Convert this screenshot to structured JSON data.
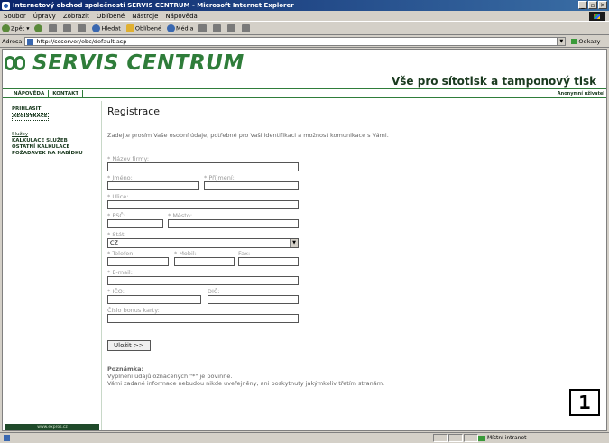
{
  "window": {
    "title": "Internetový obchod společnosti SERVIS CENTRUM - Microsoft Internet Explorer",
    "controls": [
      "_",
      "▫",
      "✕"
    ]
  },
  "menu": [
    "Soubor",
    "Úpravy",
    "Zobrazit",
    "Oblíbené",
    "Nástroje",
    "Nápověda"
  ],
  "toolbar": {
    "back": "Zpět",
    "search": "Hledat",
    "favorites": "Oblíbené",
    "media": "Média"
  },
  "address": {
    "label": "Adresa",
    "url": "http://scserver/ebc/default.asp",
    "go": "Odkazy"
  },
  "header": {
    "logo_text": "SERVIS CENTRUM",
    "slogan": "Vše pro sítotisk a tamponový tisk"
  },
  "nav": {
    "tabs": [
      "NÁPOVĚDA",
      "KONTAKT"
    ],
    "user": "Anonymní uživatel"
  },
  "sidebar": {
    "auth": [
      "PŘIHLÁSIT",
      "REGISTRACE"
    ],
    "links": [
      "Služby",
      "KALKULACE SLUŽEB",
      "OSTATNÍ KALKULACE",
      "POŽADAVEK NA NABÍDKU"
    ],
    "footer": "www.expros.cz"
  },
  "form": {
    "title": "Registrace",
    "intro": "Zadejte prosím Vaše osobní údaje, potřebné pro Vaši identifikaci a možnost komunikace s Vámi.",
    "labels": {
      "company": "* Název firmy:",
      "first_name": "* Jméno:",
      "last_name": "* Příjmení:",
      "street": "* Ulice:",
      "zip": "* PSČ:",
      "city": "* Město:",
      "country": "* Stát:",
      "phone": "* Telefon:",
      "mobile": "* Mobil:",
      "fax": "Fax:",
      "email": "* E-mail:",
      "ico": "* IČO:",
      "dic": "DIČ:",
      "bonus": "Číslo bonus karty:"
    },
    "country_value": "CZ",
    "save_label": "Uložit >>",
    "note_title": "Poznámka:",
    "note_lines": [
      "Vyplnění údajů označených \"*\" je povinné.",
      "Vámi zadané informace nebudou nikde uveřejněny, ani poskytnuty jakýmkoliv třetím stranám."
    ]
  },
  "status": {
    "zone": "Místní intranet"
  },
  "marker": "1"
}
